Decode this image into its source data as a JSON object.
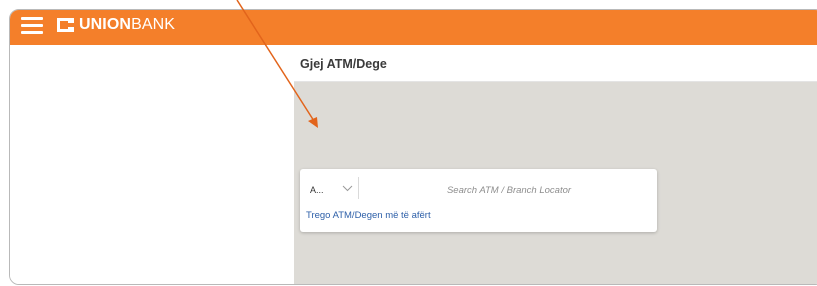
{
  "header": {
    "brand_strong": "UNION",
    "brand_light": "BANK",
    "icon": "hamburger-menu-icon",
    "logo_icon": "unionbank-logo-mark",
    "color": "#f47f2a"
  },
  "main": {
    "title": "Gjej ATM/Dege",
    "search": {
      "type_value": "A...",
      "placeholder": "Search ATM / Branch Locator",
      "nearest_link": "Trego ATM/Degen më të afërt"
    }
  },
  "colors": {
    "map_background": "#dddbd6",
    "link": "#2d5fa8",
    "annotation_arrow": "#e2641b"
  }
}
